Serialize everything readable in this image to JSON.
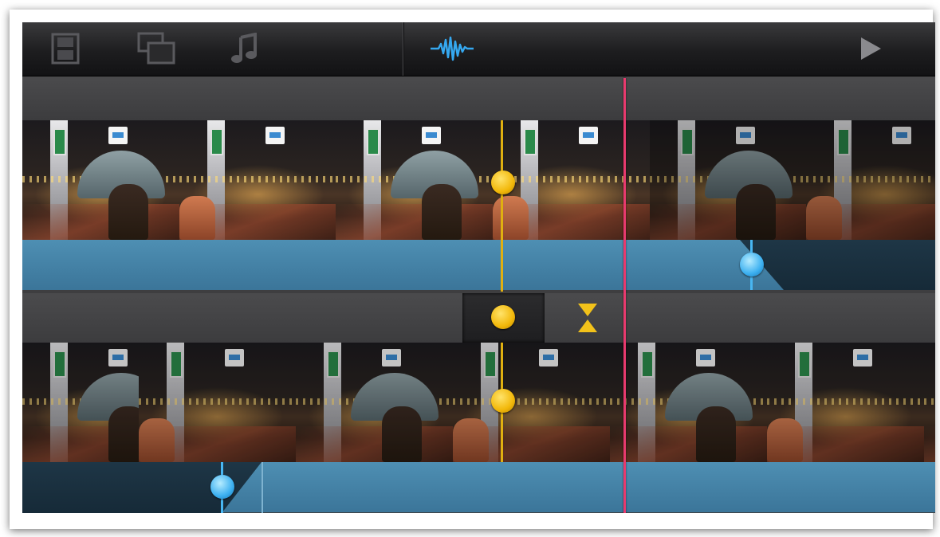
{
  "window": {},
  "toolbar": {
    "left_icons": [
      "filmstrip-icon",
      "picture-in-picture-icon",
      "music-note-icon"
    ],
    "waveform_icon": "waveform-icon",
    "play_icon": "play-icon"
  },
  "timeline": {
    "tracks": [
      "primary-video-track",
      "secondary-video-track"
    ],
    "transition_marker": "hourglass-icon"
  },
  "colors": {
    "playhead": "#e83a6e",
    "track_marker": "#e0b010",
    "audio_band": "#4e8fb3",
    "volume_handle": "#3cb0f0"
  }
}
